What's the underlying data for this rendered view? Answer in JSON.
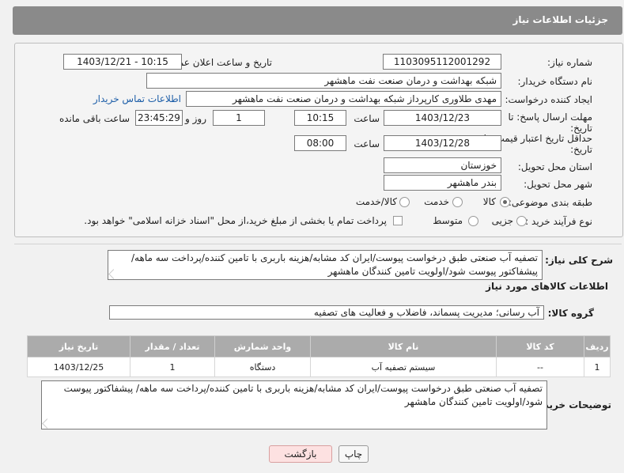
{
  "header": {
    "title": "جزئیات اطلاعات نیاز"
  },
  "form": {
    "need_number_label": "شماره نیاز:",
    "need_number": "1103095112001292",
    "announce_label": "تاریخ و ساعت اعلان عمومی:",
    "announce_value": "1403/12/21 - 10:15",
    "buyer_org_label": "نام دستگاه خریدار:",
    "buyer_org": "شبکه بهداشت و درمان صنعت نفت ماهشهر",
    "creator_label": "ایجاد کننده درخواست:",
    "creator": "مهدی طلاوری کارپرداز شبکه بهداشت و درمان صنعت نفت ماهشهر",
    "contact_link": "اطلاعات تماس خریدار",
    "reply_deadline_label_1": "مهلت ارسال پاسخ: تا",
    "reply_deadline_label_2": "تاریخ:",
    "reply_date": "1403/12/23",
    "time_label": "ساعت",
    "reply_time": "10:15",
    "days_value": "1",
    "days_label": "روز و",
    "remaining_time": "23:45:29",
    "remaining_label": "ساعت باقی مانده",
    "price_validity_label_1": "حداقل تاریخ اعتبار قیمت: تا",
    "price_validity_label_2": "تاریخ:",
    "price_date": "1403/12/28",
    "price_time": "08:00",
    "province_label": "استان محل تحویل:",
    "province": "خوزستان",
    "city_label": "شهر محل تحویل:",
    "city": "بندر ماهشهر",
    "category_label": "طبقه بندی موضوعی:",
    "category_options": [
      "کالا",
      "خدمت",
      "کالا/خدمت"
    ],
    "process_label": "نوع فرآیند خرید :",
    "process_options": [
      "جزیی",
      "متوسط"
    ],
    "payment_note": "پرداخت تمام یا بخشی از مبلغ خرید،از محل \"اسناد خزانه اسلامی\" خواهد بود."
  },
  "description": {
    "label": "شرح کلی نیاز:",
    "text": "تصفیه آب صنعتی طبق درخواست پیوست/ایران کد مشابه/هزینه باربری با تامین کننده/پرداخت سه ماهه/ پیشفاکتور پیوست شود/اولویت تامین کنندگان ماهشهر"
  },
  "goods_section": {
    "title": "اطلاعات کالاهای مورد نیاز",
    "group_label": "گروه کالا:",
    "group_value": "آب رسانی؛ مدیریت پسماند، فاضلاب و فعالیت های تصفیه"
  },
  "table": {
    "headers": [
      "ردیف",
      "کد کالا",
      "نام کالا",
      "واحد شمارش",
      "تعداد / مقدار",
      "تاریخ نیاز"
    ],
    "rows": [
      [
        "1",
        "--",
        "سیستم تصفیه آب",
        "دستگاه",
        "1",
        "1403/12/25"
      ]
    ]
  },
  "buyer_notes": {
    "label": "توضیحات خریدار:",
    "text": "تصفیه آب صنعتی طبق درخواست پیوست/ایران کد مشابه/هزینه باربری با تامین کننده/پرداخت سه ماهه/ پیشفاکتور پیوست شود/اولویت تامین کنندگان ماهشهر"
  },
  "buttons": {
    "print": "چاپ",
    "back": "بازگشت"
  }
}
